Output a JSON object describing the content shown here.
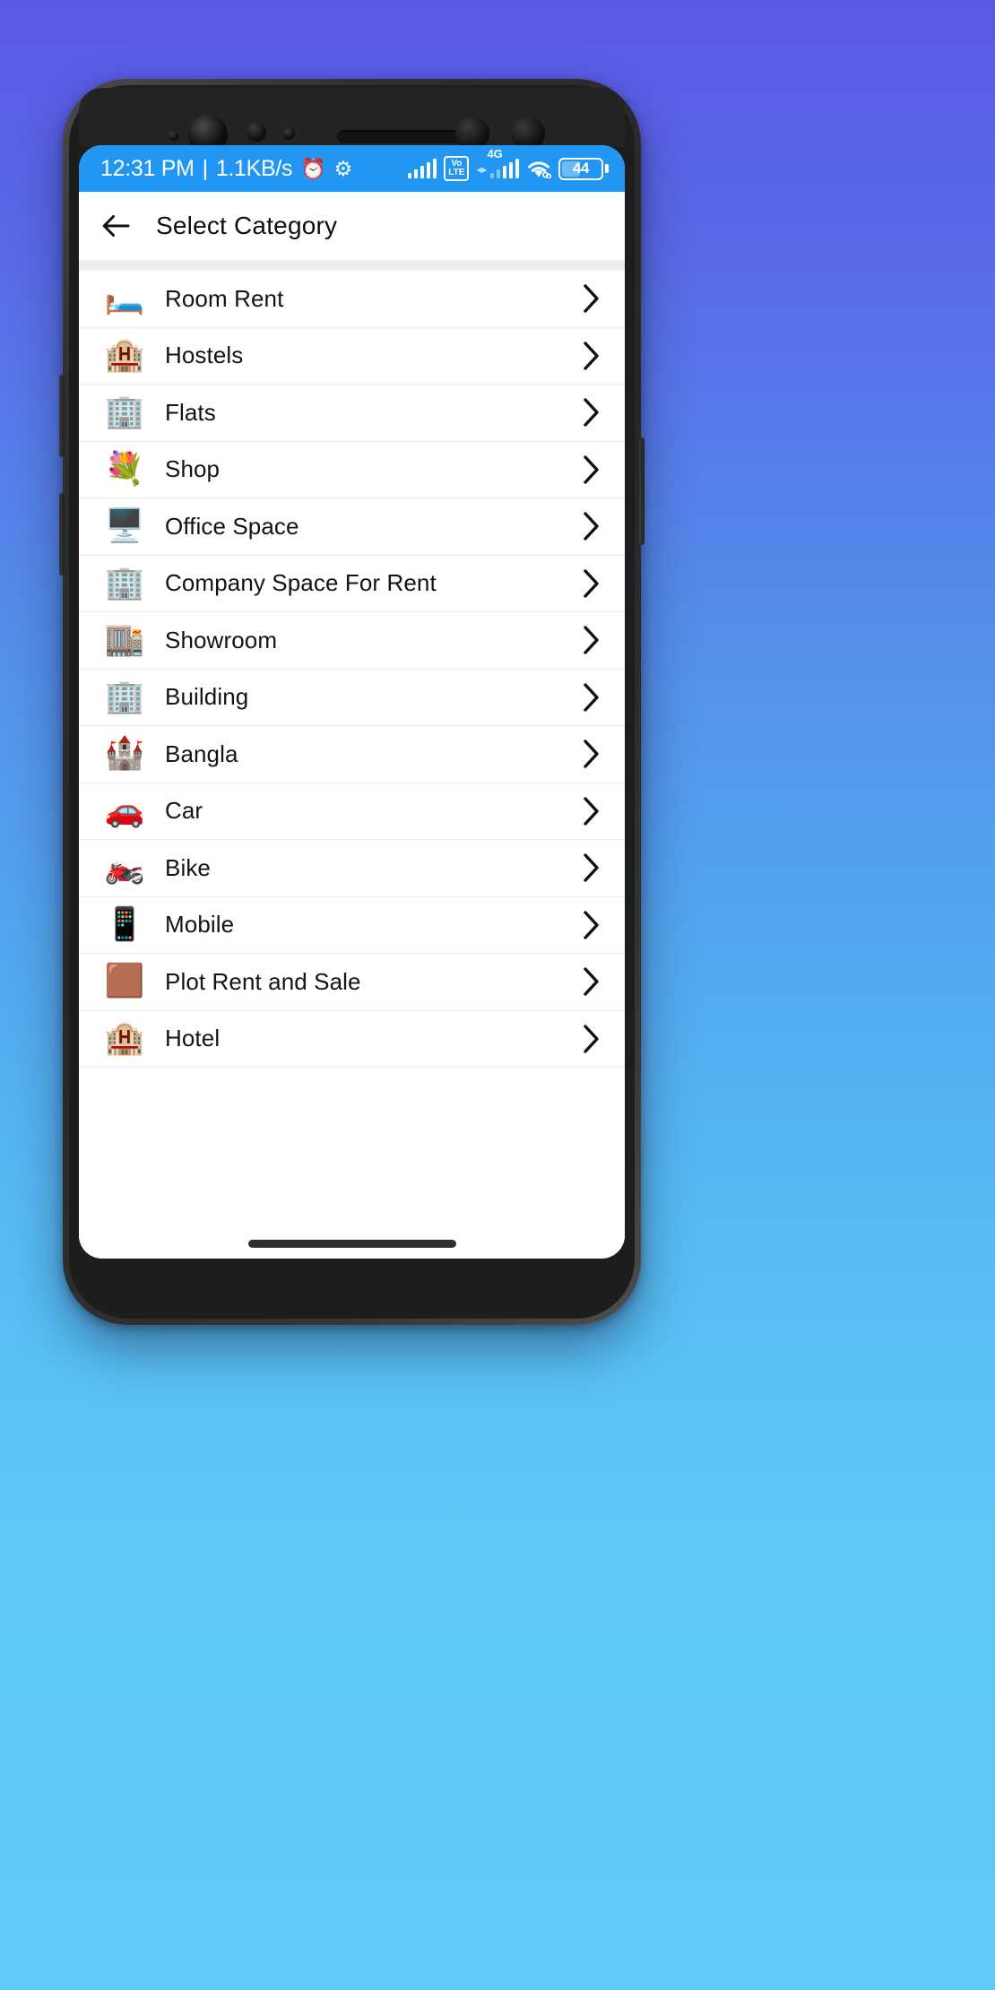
{
  "background": {
    "gradient_top": "#5b58e8",
    "gradient_bottom": "#5ecbf7"
  },
  "status_bar": {
    "background_color": "#2196f3",
    "time": "12:31 PM",
    "separator": "|",
    "network_speed": "1.1KB/s",
    "alarm_icon": "alarm-clock-icon",
    "settings_icon": "gear-icon",
    "sim1_signal_icon": "signal-bars-icon",
    "volte_line1": "Vo",
    "volte_line2": "LTE",
    "network_type": "4G",
    "data_arrows": "◂▸",
    "sim2_signal_icon": "signal-bars-icon",
    "wifi_icon": "wifi-icon",
    "battery_level": "44",
    "battery_percent": 44
  },
  "app_bar": {
    "back_icon": "arrow-left-icon",
    "title": "Select Category"
  },
  "list": {
    "chevron_icon": "chevron-right-icon",
    "items": [
      {
        "label": "Room Rent",
        "emoji": "🛏️",
        "icon_name": "bed-icon"
      },
      {
        "label": "Hostels",
        "emoji": "🏨",
        "icon_name": "hotel-building-icon"
      },
      {
        "label": "Flats",
        "emoji": "🏢",
        "icon_name": "office-buildings-icon"
      },
      {
        "label": "Shop",
        "emoji": "💐",
        "icon_name": "shop-storefront-icon"
      },
      {
        "label": "Office Space",
        "emoji": "🖥️",
        "icon_name": "office-desk-icon"
      },
      {
        "label": "Company Space For Rent",
        "emoji": "🏢",
        "icon_name": "company-building-icon"
      },
      {
        "label": "Showroom",
        "emoji": "🏬",
        "icon_name": "car-showroom-icon"
      },
      {
        "label": "Building",
        "emoji": "🏢",
        "icon_name": "building-icon"
      },
      {
        "label": "Bangla",
        "emoji": "🏰",
        "icon_name": "castle-icon"
      },
      {
        "label": "Car",
        "emoji": "🚗",
        "icon_name": "car-icon"
      },
      {
        "label": "Bike",
        "emoji": "🏍️",
        "icon_name": "motorcycle-icon"
      },
      {
        "label": "Mobile",
        "emoji": "📱",
        "icon_name": "mobile-phone-icon"
      },
      {
        "label": "Plot Rent and Sale",
        "emoji": "🟫",
        "icon_name": "farm-plot-icon"
      },
      {
        "label": "Hotel",
        "emoji": "🏨",
        "icon_name": "hotel-sign-icon"
      }
    ]
  },
  "navigation": {
    "home_indicator": "home-indicator-bar"
  }
}
